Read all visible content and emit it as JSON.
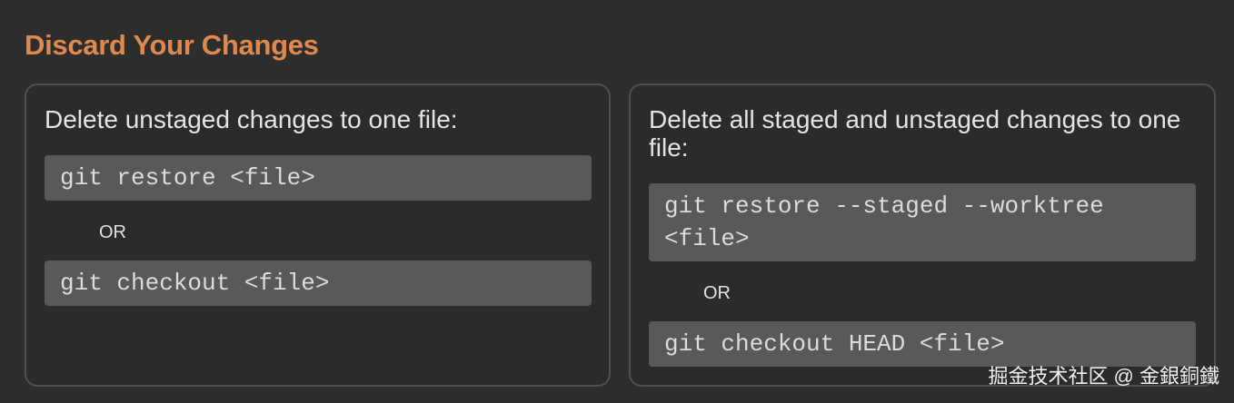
{
  "section": {
    "title": "Discard Your Changes"
  },
  "left_card": {
    "heading": "Delete unstaged changes to one file:",
    "command_1": "git restore <file>",
    "separator": "OR",
    "command_2": "git checkout <file>"
  },
  "right_card": {
    "heading": "Delete all staged and unstaged changes to one file:",
    "command_1": "git restore --staged --worktree <file>",
    "separator": "OR",
    "command_2": "git checkout HEAD <file>"
  },
  "watermark": "掘金技术社区 @ 金銀銅鐵",
  "colors": {
    "background": "#2d2d2d",
    "title": "#e0894e",
    "code_block": "#595959",
    "card_border": "#4f4f4f"
  }
}
